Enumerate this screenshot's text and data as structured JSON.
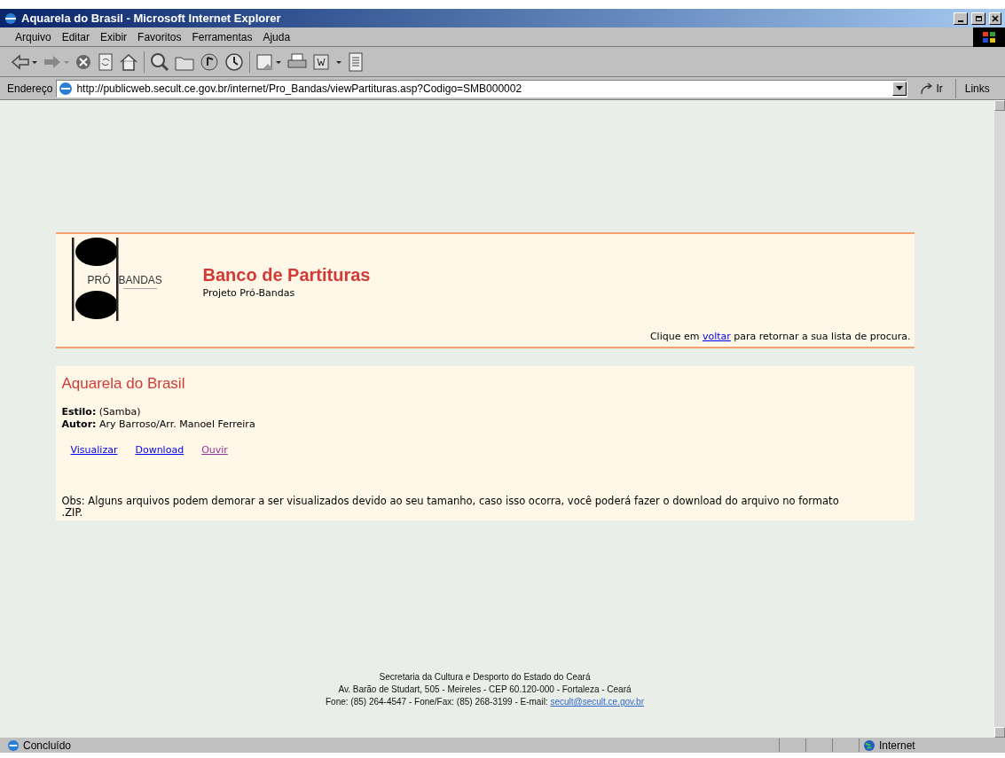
{
  "window": {
    "title": "Aquarela do Brasil - Microsoft Internet Explorer"
  },
  "menu": [
    "Arquivo",
    "Editar",
    "Exibir",
    "Favoritos",
    "Ferramentas",
    "Ajuda"
  ],
  "address_bar": {
    "label": "Endereço",
    "url": "http://publicweb.secult.ce.gov.br/internet/Pro_Bandas/viewPartituras.asp?Codigo=SMB000002",
    "go": "Ir",
    "links": "Links"
  },
  "header": {
    "logo": {
      "word_1": "PRÓ",
      "word_2": "BANDAS"
    },
    "title": "Banco de Partituras",
    "subtitle": "Projeto Pró-Bandas",
    "back_note": {
      "before": "Clique em",
      "link": "voltar",
      "after": "para retornar a sua lista de procura."
    }
  },
  "piece": {
    "title": "Aquarela do Brasil",
    "fields": [
      {
        "label": "Estilo:",
        "value": "(Samba)"
      },
      {
        "label": "Autor:",
        "value": "Ary Barroso/Arr. Manoel Ferreira"
      }
    ],
    "links": [
      {
        "label": "Visualizar",
        "visited": false
      },
      {
        "label": "Download",
        "visited": false
      },
      {
        "label": "Ouvir",
        "visited": true
      }
    ],
    "note": "Obs: Alguns arquivos podem demorar a ser visualizados devido ao seu tamanho, caso isso ocorra, você poderá fazer o download do arquivo no formato .ZIP."
  },
  "footer": {
    "lines": [
      "Secretaria da Cultura e Desporto do Estado do Ceará",
      "Av. Barão de Studart, 505 - Meireles - CEP 60.120-000 - Fortaleza - Ceará"
    ],
    "contact": "Fone: (85) 264-4547 - Fone/Fax: (85) 268-3199 - E-mail:",
    "email": "secult@secult.ce.gov.br"
  },
  "status_bar": {
    "text": "Concluído",
    "zone": "Internet"
  }
}
